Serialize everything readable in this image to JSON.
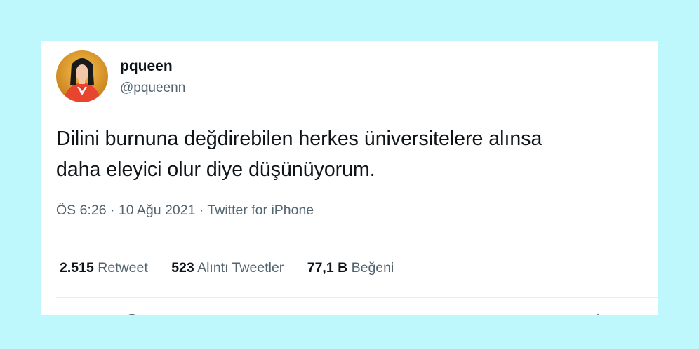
{
  "user": {
    "display_name": "pqueen",
    "handle": "@pqueenn"
  },
  "tweet": {
    "text_line1": "Dilini burnuna değdirebilen herkes üniversitelere alınsa",
    "text_line2": "daha eleyici olur diye düşünüyorum.",
    "time": "ÖS 6:26",
    "separator": "·",
    "date": "10 Ağu 2021",
    "source": "Twitter for iPhone"
  },
  "stats": [
    {
      "value": "2.515",
      "label": "Retweet"
    },
    {
      "value": "523",
      "label": "Alıntı Tweetler"
    },
    {
      "value": "77,1 B",
      "label": "Beğeni"
    }
  ],
  "actions": [
    {
      "icon": "reply-icon"
    },
    {
      "icon": "retweet-icon"
    },
    {
      "icon": "like-icon"
    },
    {
      "icon": "share-icon"
    }
  ],
  "colors": {
    "background": "#bff8fc",
    "card": "#ffffff",
    "text_primary": "#0f1419",
    "text_secondary": "#536471",
    "divider": "#e6ecf0"
  }
}
